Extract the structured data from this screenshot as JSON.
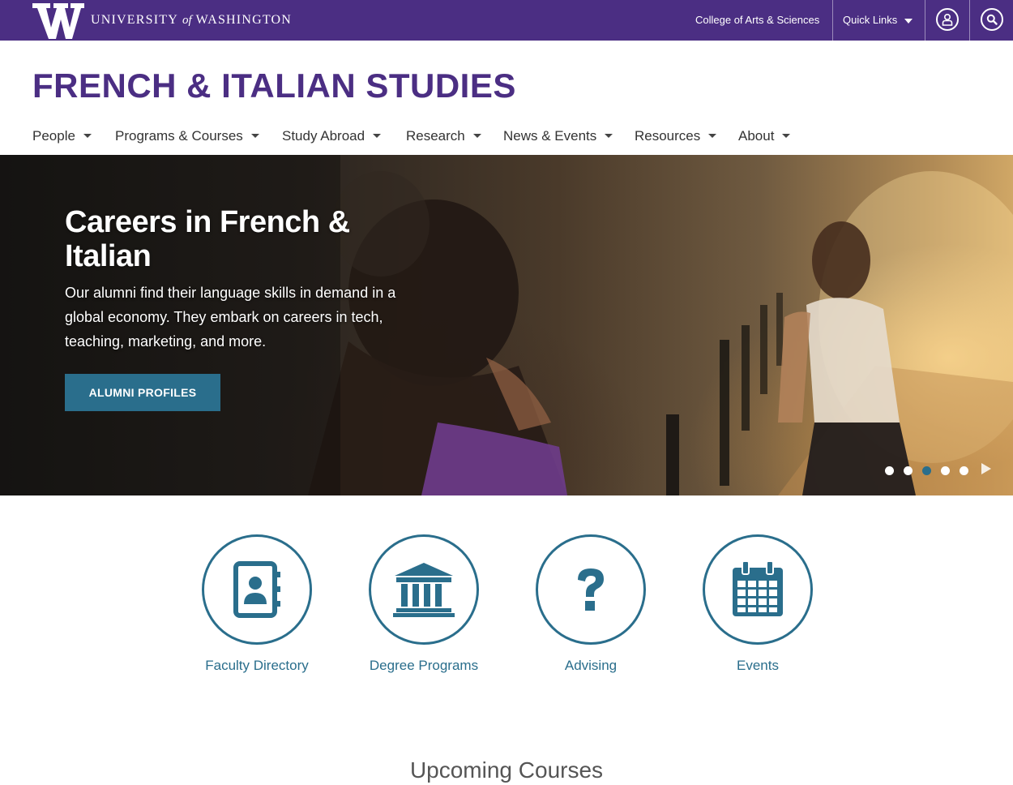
{
  "header": {
    "university": "UNIVERSITY",
    "of": "of",
    "washington": "WASHINGTON",
    "college_link": "College of Arts & Sciences",
    "quick_links": "Quick Links",
    "purple": "#4b2e83"
  },
  "site": {
    "title": "FRENCH & ITALIAN STUDIES"
  },
  "nav": {
    "items": [
      {
        "label": "People"
      },
      {
        "label": "Programs & Courses"
      },
      {
        "label": "Study Abroad"
      },
      {
        "label": "Research"
      },
      {
        "label": "News & Events"
      },
      {
        "label": "Resources"
      },
      {
        "label": "About"
      }
    ]
  },
  "hero": {
    "title": "Careers in French & Italian",
    "text": "Our alumni find their language skills in demand in a global economy. They embark on careers in tech, teaching, marketing, and more.",
    "button": "ALUMNI PROFILES",
    "active_slide": 3,
    "slide_count": 5
  },
  "quicklinks": [
    {
      "label": "Faculty Directory",
      "icon": "address-book-icon"
    },
    {
      "label": "Degree Programs",
      "icon": "institution-icon"
    },
    {
      "label": "Advising",
      "icon": "question-icon"
    },
    {
      "label": "Events",
      "icon": "calendar-icon"
    }
  ],
  "sections": {
    "upcoming_courses": "Upcoming Courses"
  },
  "colors": {
    "teal": "#2a6e8c",
    "purple": "#4b2e83"
  }
}
